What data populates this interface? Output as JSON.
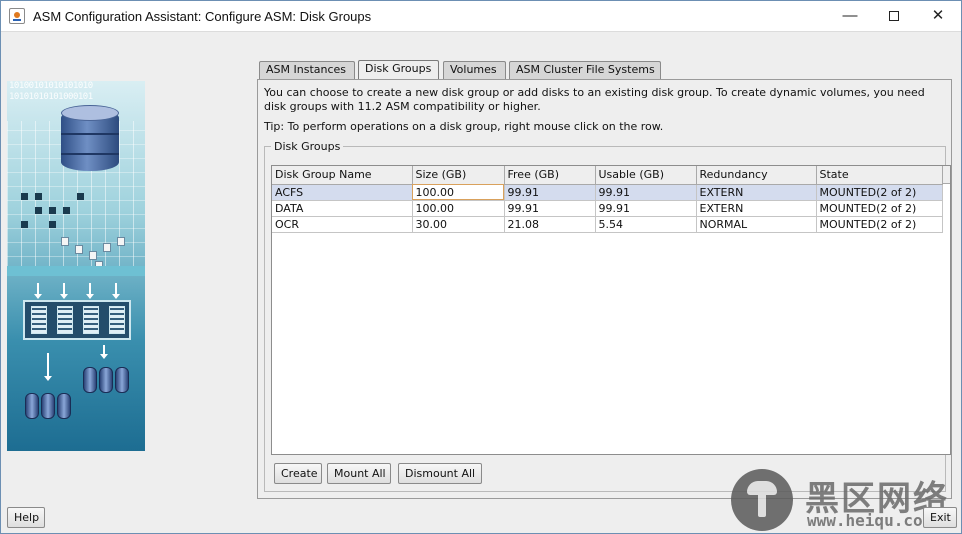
{
  "window": {
    "title": "ASM Configuration Assistant: Configure ASM: Disk Groups",
    "controls": {
      "minimize": "—",
      "close": "✕"
    }
  },
  "illustration": {
    "bits": "10100101010101010\n10101010101000101"
  },
  "tabs": [
    {
      "label": "ASM Instances",
      "active": false
    },
    {
      "label": "Disk Groups",
      "active": true
    },
    {
      "label": "Volumes",
      "active": false
    },
    {
      "label": "ASM Cluster File Systems",
      "active": false
    }
  ],
  "main": {
    "description": "You can choose to create a new disk group or add disks to an existing disk group. To create dynamic volumes, you need disk groups with 11.2 ASM compatibility or higher.",
    "tip": "Tip: To perform operations on a disk group, right mouse click on the row.",
    "group_title": "Disk Groups",
    "table": {
      "columns": [
        "Disk Group Name",
        "Size (GB)",
        "Free (GB)",
        "Usable (GB)",
        "Redundancy",
        "State"
      ],
      "rows": [
        {
          "name": "ACFS",
          "size": "100.00",
          "free": "99.91",
          "usable": "99.91",
          "redundancy": "EXTERN",
          "state": "MOUNTED(2 of 2)"
        },
        {
          "name": "DATA",
          "size": "100.00",
          "free": "99.91",
          "usable": "99.91",
          "redundancy": "EXTERN",
          "state": "MOUNTED(2 of 2)"
        },
        {
          "name": "OCR",
          "size": "30.00",
          "free": "21.08",
          "usable": "5.54",
          "redundancy": "NORMAL",
          "state": "MOUNTED(2 of 2)"
        }
      ]
    },
    "buttons": {
      "create": "Create",
      "mount_all": "Mount All",
      "dismount_all": "Dismount All"
    }
  },
  "footer": {
    "help": "Help",
    "exit": "Exit"
  },
  "watermark": {
    "name": "黑区网络",
    "url": "www.heiqu.com"
  }
}
